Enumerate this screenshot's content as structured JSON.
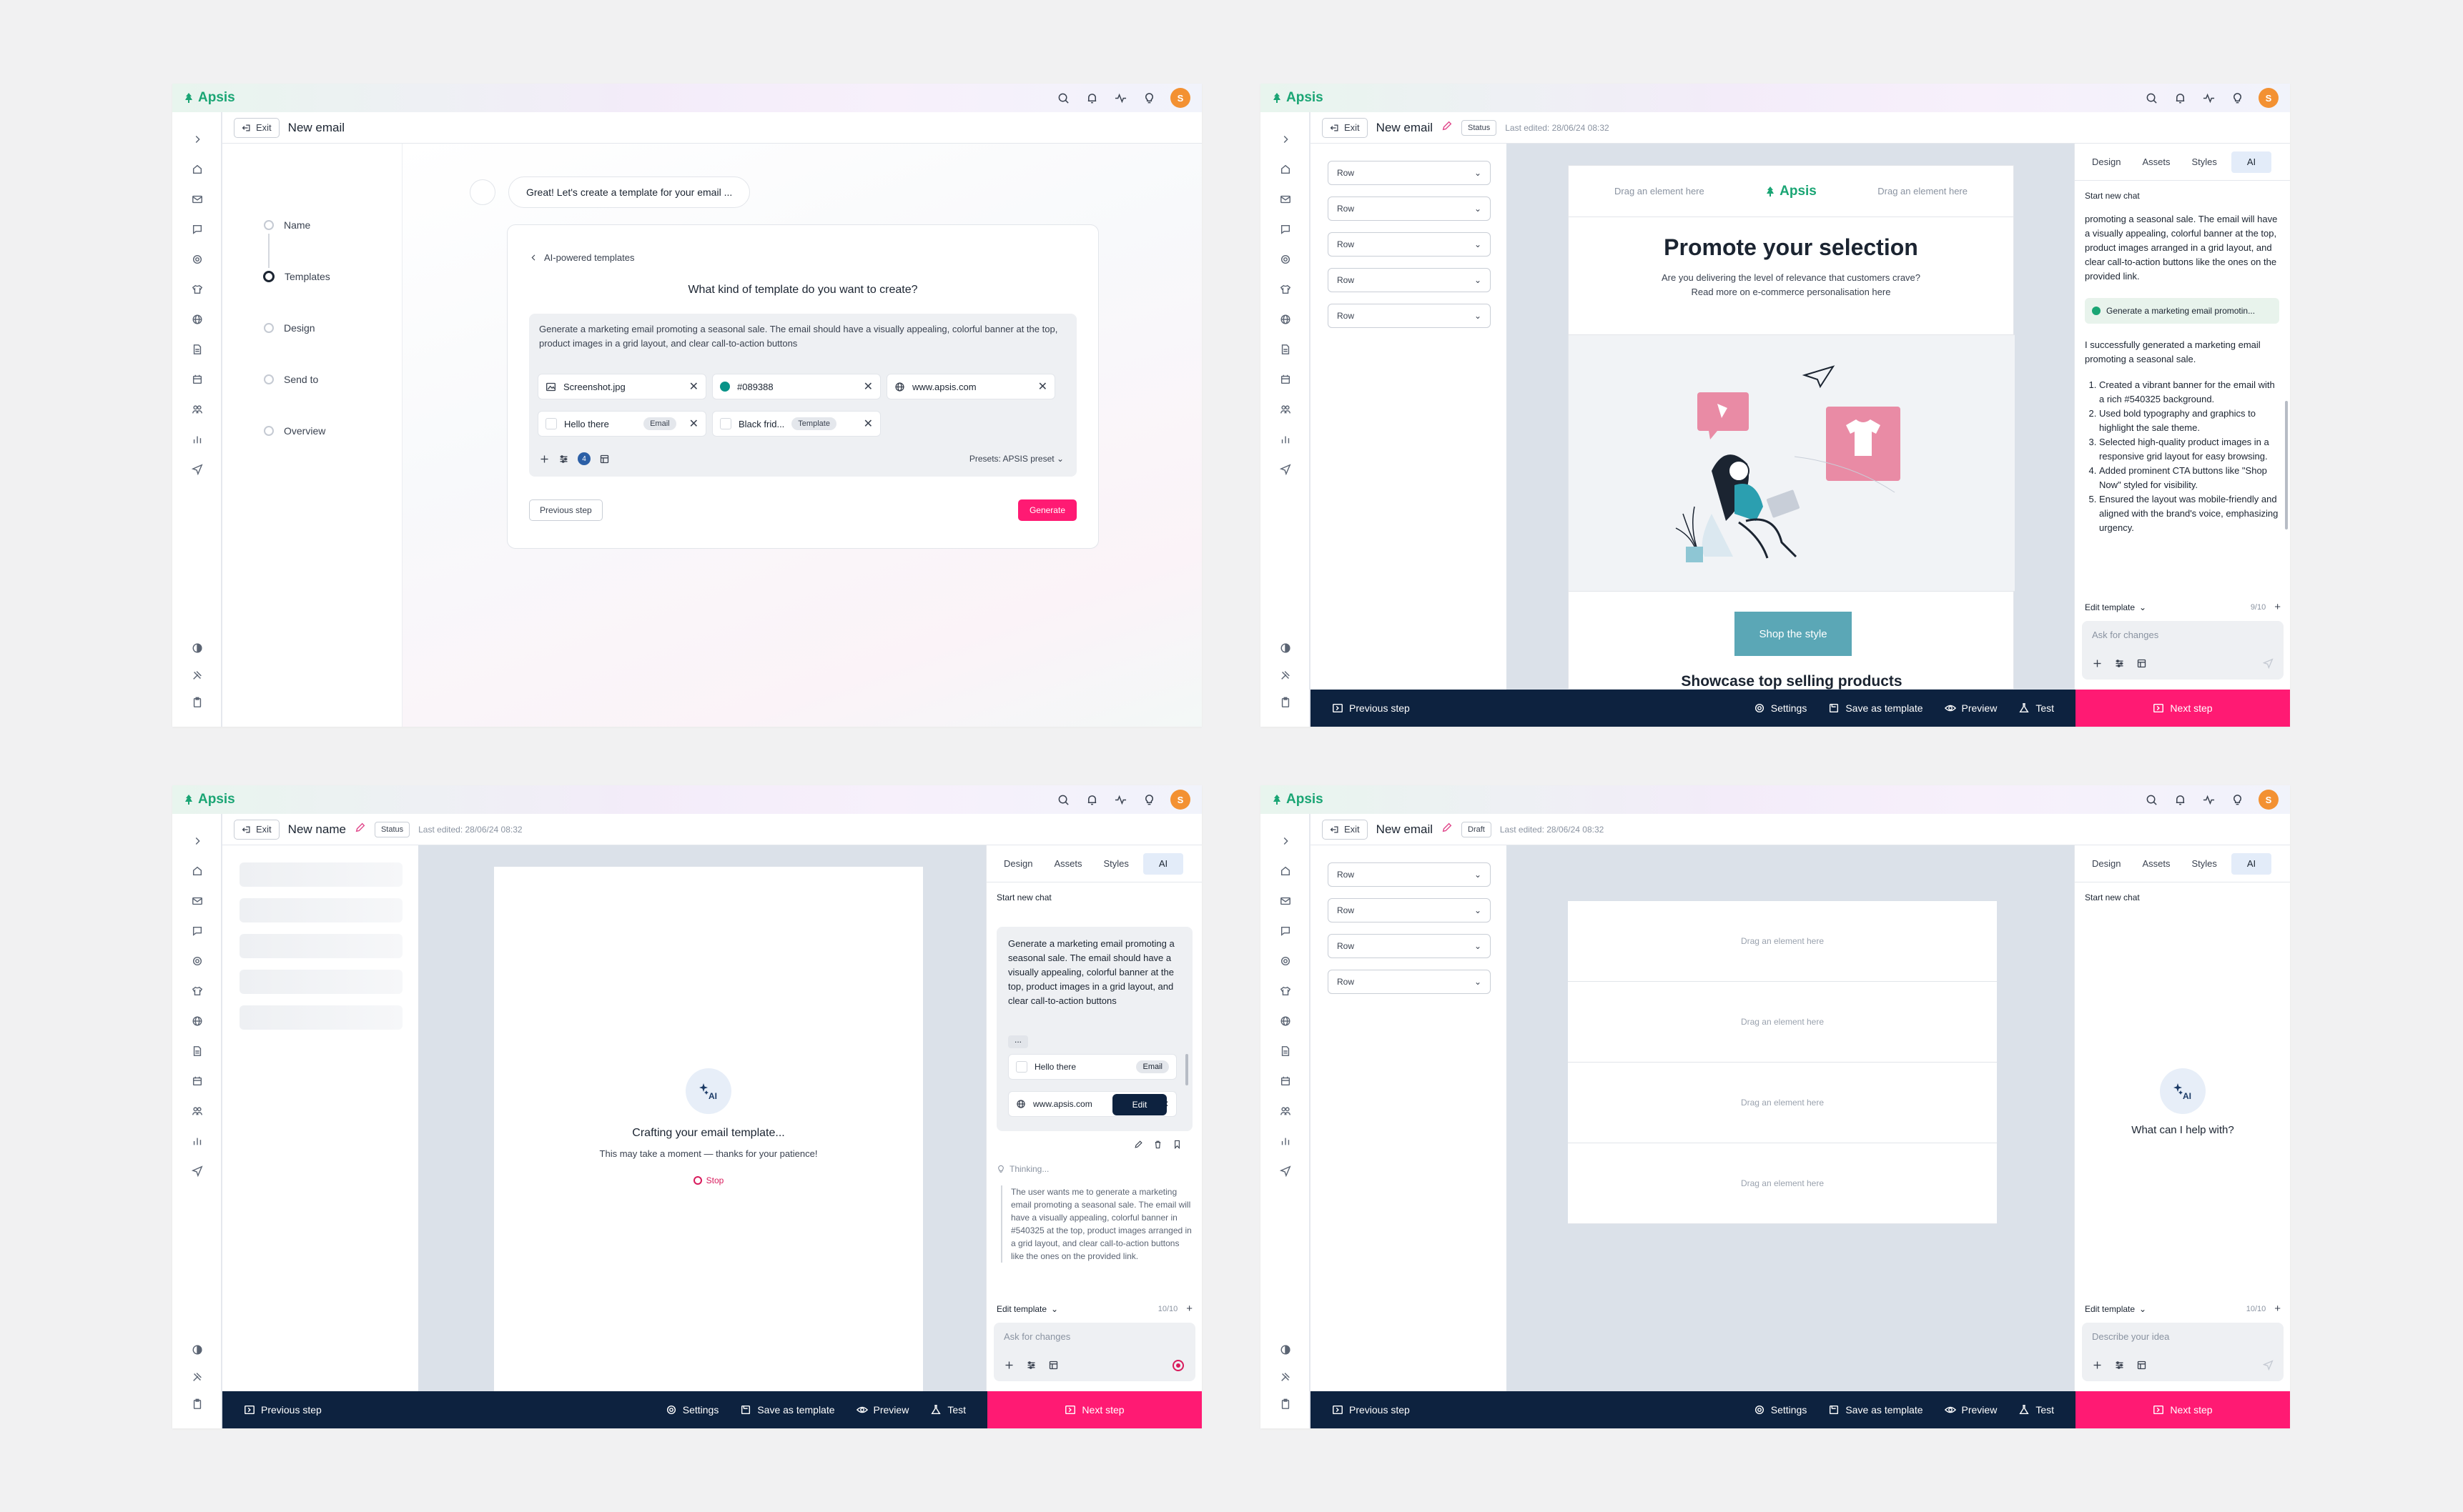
{
  "brand": "Apsis",
  "user_initial": "S",
  "colors": {
    "accent": "#ff1a73",
    "brand": "#1aa574",
    "navy": "#0d223f"
  },
  "common": {
    "exit_label": "Exit",
    "status_label": "Status",
    "last_edited": "Last edited: 28/06/24 08:32",
    "bottom": {
      "previous": "Previous step",
      "settings": "Settings",
      "save_template": "Save as template",
      "preview": "Preview",
      "test": "Test",
      "next": "Next step"
    },
    "tabs": [
      "Design",
      "Assets",
      "Styles",
      "AI"
    ],
    "start_new_chat": "Start new chat",
    "edit_template": "Edit template"
  },
  "panel1": {
    "title": "New email",
    "steps": [
      "Name",
      "Templates",
      "Design",
      "Send to",
      "Overview"
    ],
    "active_step": "Templates",
    "bubble": "Great! Let's create a template for your email ...",
    "back_label": "AI-powered templates",
    "question": "What kind of template do you want to create?",
    "prompt": "Generate a marketing email promoting a seasonal sale. The email should have a visually appealing, colorful banner at the top, product images in a grid layout, and clear call-to-action buttons",
    "chips": {
      "screenshot": "Screenshot.jpg",
      "color": "#089388",
      "url": "www.apsis.com",
      "hello": "Hello there",
      "hello_tag": "Email",
      "black": "Black frid...",
      "black_tag": "Template"
    },
    "badge_count": "4",
    "presets": "Presets: APSIS preset",
    "prev_button": "Previous step",
    "generate_button": "Generate"
  },
  "panel2": {
    "title": "New email",
    "rows": [
      "Row",
      "Row",
      "Row",
      "Row",
      "Row"
    ],
    "email": {
      "drag_left": "Drag an element here",
      "drag_right": "Drag an element here",
      "logo": "Apsis",
      "heading": "Promote your selection",
      "sub1": "Are you delivering the level of relevance that customers crave?",
      "sub2": "Read more on e-commerce personalisation here",
      "cta": "Shop the style",
      "showcase": "Showcase top selling products"
    },
    "chat_intro": "promoting a seasonal sale. The email will have a visually appealing, colorful banner at the top, product images arranged in a grid layout, and clear call-to-action buttons like the ones on the provided link.",
    "pill": "Generate a marketing email promotin...",
    "success": "I successfully generated a marketing email promoting a seasonal sale.",
    "list": [
      "Created a vibrant banner for the email with a rich #540325 background.",
      "Used bold typography and graphics to highlight the sale theme.",
      "Selected high-quality product images in a responsive grid layout for easy browsing.",
      "Added prominent CTA buttons like \"Shop Now\" styled for visibility.",
      "Ensured the layout was mobile-friendly and aligned with the brand's voice, emphasizing urgency."
    ],
    "count": "9/10",
    "ask_placeholder": "Ask for changes"
  },
  "panel3": {
    "title": "New name",
    "crafting": "Crafting your email template...",
    "crafting_sub": "This may take a moment — thanks for your patience!",
    "stop": "Stop",
    "message": "Generate a marketing email promoting a seasonal sale. The email should have a visually appealing, colorful banner at the top, product images in a grid layout, and clear call-to-action buttons",
    "dots": "...",
    "chip_hello": "Hello there",
    "chip_hello_tag": "Email",
    "chip_url": "www.apsis.com",
    "tooltip": "Edit",
    "thinking": "Thinking...",
    "thought": "The user wants me to generate a marketing email promoting a seasonal sale. The email will have a visually appealing, colorful banner in #540325 at the top, product images arranged in a grid layout, and clear call-to-action buttons like the ones on the provided link.",
    "count": "10/10",
    "ask_placeholder": "Ask for changes"
  },
  "panel4": {
    "title": "New email",
    "status": "Draft",
    "rows": [
      "Row",
      "Row",
      "Row",
      "Row"
    ],
    "drag": [
      "Drag an element here",
      "Drag an element here",
      "Drag an element here",
      "Drag an element here"
    ],
    "help": "What can I help with?",
    "count": "10/10",
    "ask_placeholder": "Describe your idea"
  }
}
